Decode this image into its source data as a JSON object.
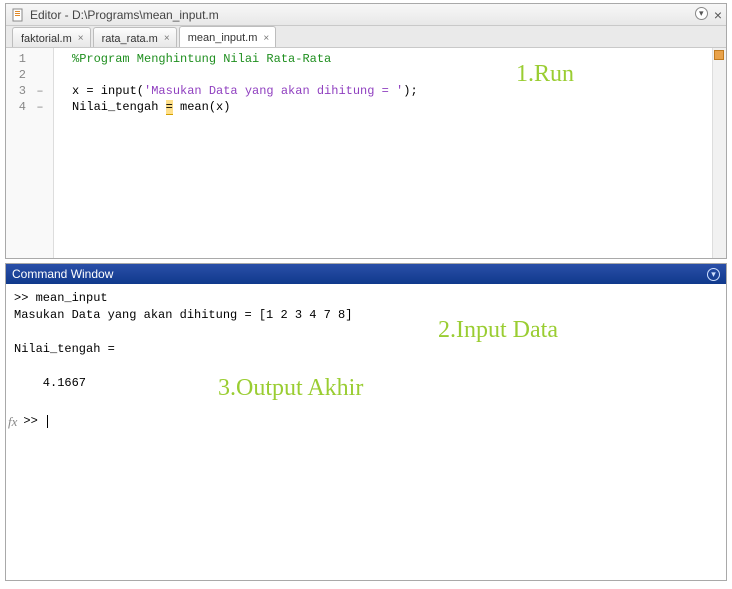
{
  "editor": {
    "title": "Editor - D:\\Programs\\mean_input.m",
    "tabs": [
      {
        "label": "faktorial.m",
        "active": false
      },
      {
        "label": "rata_rata.m",
        "active": false
      },
      {
        "label": "mean_input.m",
        "active": true
      }
    ],
    "code": {
      "line1_comment": "%Program Menghintung Nilai Rata-Rata",
      "line3_pre": "x = input(",
      "line3_str": "'Masukan Data yang akan dihitung = '",
      "line3_post": ");",
      "line4_pre": "Nilai_tengah ",
      "line4_eq": "=",
      "line4_post": " mean(x)",
      "gutter": [
        "1",
        "2",
        "3",
        "4"
      ],
      "dash": [
        "",
        "",
        "–",
        "–"
      ]
    }
  },
  "cmd": {
    "title": "Command Window",
    "output": ">> mean_input\nMasukan Data yang akan dihitung = [1 2 3 4 7 8]\n\nNilai_tengah =\n\n    4.1667\n\n",
    "prompt": ">> "
  },
  "annotations": {
    "a1": "1.Run",
    "a2": "2.Input Data",
    "a3": "3.Output Akhir"
  },
  "fx_label": "fx",
  "close_glyph": "×"
}
